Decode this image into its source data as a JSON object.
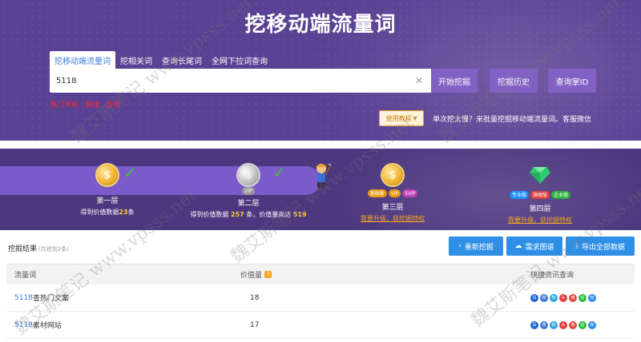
{
  "header": {
    "title": "挖移动端流量词",
    "tabs": [
      {
        "label": "挖移动端流量词",
        "active": true
      },
      {
        "label": "挖相关词",
        "active": false
      },
      {
        "label": "查询长尾词",
        "active": false
      },
      {
        "label": "全网下拉词查询",
        "active": false
      }
    ],
    "search": {
      "value": "5118"
    },
    "start_label": "开始挖掘",
    "history_label": "挖掘历史",
    "id_label": "查询掌ID",
    "quick_links": [
      "热门手机",
      "游戏",
      "影视"
    ],
    "tutorial_label": "使用教程",
    "tip": "单次挖太慢？来批量挖掘移动端流量词。客服微信"
  },
  "levels": [
    {
      "title": "第一层",
      "desc_prefix": "得到价值数据",
      "desc_num": "23",
      "desc_suffix": "条",
      "icon": "gold-coin-icon",
      "checked": true
    },
    {
      "title": "第二层",
      "desc_prefix": "得到价值数据",
      "desc_num": "257",
      "desc_mid": "条，价值量高达",
      "desc_num2": "519",
      "icon": "silver-coin-icon",
      "checked": true,
      "badges": [
        "VIP"
      ]
    },
    {
      "title": "第三层",
      "link": "我要升级，获挖掘特权",
      "icon": "gold-coin-icon",
      "badges": [
        "基础版",
        "VIP",
        "SVIP"
      ]
    },
    {
      "title": "第四层",
      "link": "我要升级，获挖掘特权",
      "icon": "green-gem-icon",
      "badges": [
        "专业版",
        "旗舰版",
        "企业版"
      ]
    }
  ],
  "results": {
    "title": "挖掘结果",
    "hint": "(共挖到2条)",
    "redo_label": "重新挖掘",
    "image_label": "需求图谱",
    "export_label": "导出全部数据",
    "columns": [
      "流量词",
      "价值量",
      "快捷资讯查询"
    ],
    "rows": [
      {
        "brand": "5118",
        "rest": "查热门文案",
        "value": "18"
      },
      {
        "brand": "5118",
        "rest": "素材网站",
        "value": "17"
      }
    ]
  },
  "watermark": "魏艾斯笔记 www.vpsss.net",
  "colors": {
    "header_bg": "#5a4194",
    "levels_bg": "#4d387f",
    "primary_btn": "#2f8fe6",
    "accent_purple": "#8161c4",
    "link": "#3d7fd6"
  }
}
